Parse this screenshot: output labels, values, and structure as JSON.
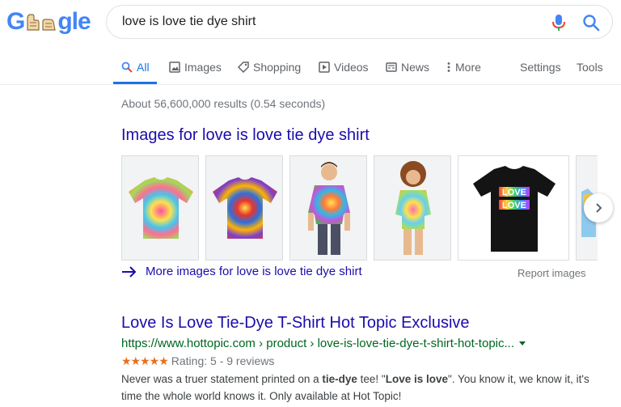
{
  "logo": {
    "letters": [
      "G",
      "gle"
    ]
  },
  "search": {
    "query": "love is love tie dye shirt"
  },
  "tabs": [
    {
      "label": "All",
      "icon": "search-icon"
    },
    {
      "label": "Images",
      "icon": "image-icon"
    },
    {
      "label": "Shopping",
      "icon": "tag-icon"
    },
    {
      "label": "Videos",
      "icon": "play-icon"
    },
    {
      "label": "News",
      "icon": "news-icon"
    },
    {
      "label": "More",
      "icon": "dots-vertical-icon"
    }
  ],
  "tools": {
    "settings": "Settings",
    "tools": "Tools"
  },
  "stats": "About 56,600,000 results (0.54 seconds)",
  "images_section": {
    "heading": "Images for love is love tie dye shirt",
    "more_link": "More images for love is love tie dye shirt",
    "report": "Report images"
  },
  "result": {
    "title": "Love Is Love Tie-Dye T-Shirt Hot Topic Exclusive",
    "url": "https://www.hottopic.com › product › love-is-love-tie-dye-t-shirt-hot-topic...",
    "stars": "★★★★★",
    "rating": "Rating: 5 - 9 reviews",
    "snippet": {
      "p1": "Never was a truer statement printed on a ",
      "b1": "tie-dye",
      "p2": " tee! \"",
      "b2": "Love is love",
      "p3": "\". You know it, we know it, it's time the whole world knows it. Only available at Hot Topic!"
    }
  },
  "shirt_print": {
    "line1": "LOVE",
    "line2": "LOVE"
  },
  "colors": {
    "link": "#1a0dab",
    "url": "#006621",
    "accent": "#1a73e8",
    "stars": "#e7711b"
  }
}
